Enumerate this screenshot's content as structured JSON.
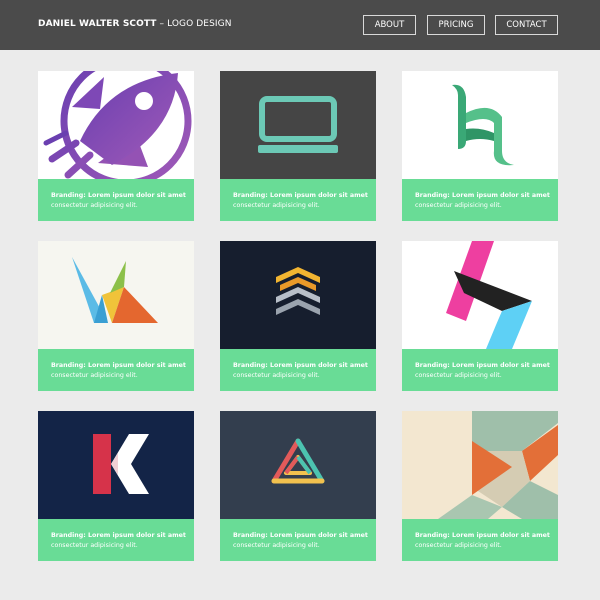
{
  "header": {
    "brand_name": "DANIEL WALTER SCOTT",
    "brand_sub": " – LOGO DESIGN",
    "nav": [
      "ABOUT",
      "PRICING",
      "CONTACT"
    ]
  },
  "colors": {
    "header_bg": "#4b4b4b",
    "page_bg": "#ebebeb",
    "caption_bg": "#69dc96"
  },
  "cards": [
    {
      "title": "Branding: Lorem ipsum dolor sit amet",
      "desc": "consectetur adipisicing elit.",
      "logo": "rocket-logo"
    },
    {
      "title": "Branding: Lorem ipsum dolor sit amet",
      "desc": "consectetur adipisicing elit.",
      "logo": "laptop-logo"
    },
    {
      "title": "Branding: Lorem ipsum dolor sit amet",
      "desc": "consectetur adipisicing elit.",
      "logo": "ribbon-letter-logo"
    },
    {
      "title": "Branding: Lorem ipsum dolor sit amet",
      "desc": "consectetur adipisicing elit.",
      "logo": "origami-bird-logo"
    },
    {
      "title": "Branding: Lorem ipsum dolor sit amet",
      "desc": "consectetur adipisicing elit.",
      "logo": "stacked-chevrons-logo"
    },
    {
      "title": "Branding: Lorem ipsum dolor sit amet",
      "desc": "consectetur adipisicing elit.",
      "logo": "folded-letter-a-logo"
    },
    {
      "title": "Branding: Lorem ipsum dolor sit amet",
      "desc": "consectetur adipisicing elit.",
      "logo": "letter-k-logo"
    },
    {
      "title": "Branding: Lorem ipsum dolor sit amet",
      "desc": "consectetur adipisicing elit.",
      "logo": "triangle-knot-logo"
    },
    {
      "title": "Branding: Lorem ipsum dolor sit amet",
      "desc": "consectetur adipisicing elit.",
      "logo": "ribbon-pattern-logo"
    }
  ]
}
